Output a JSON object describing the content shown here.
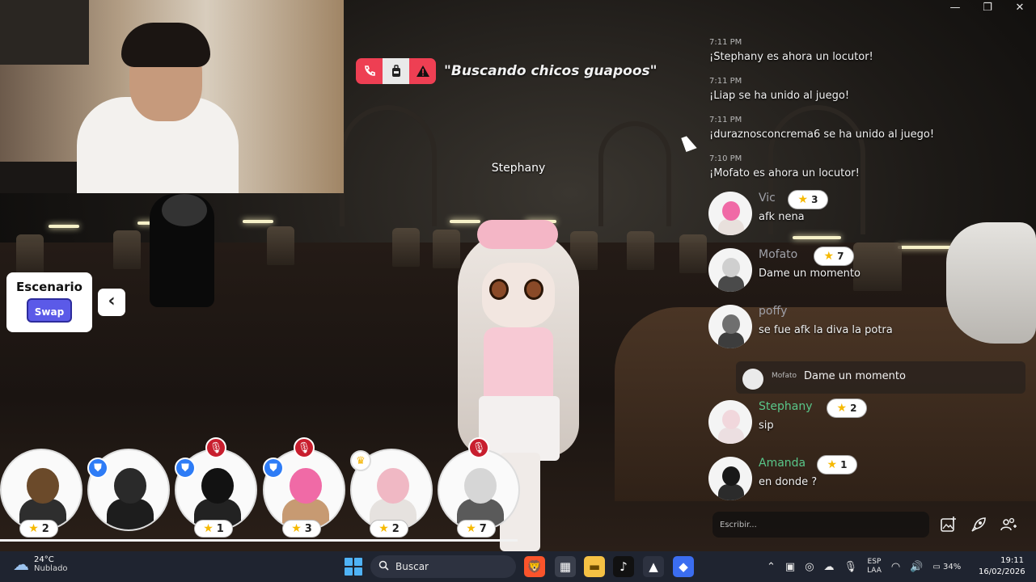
{
  "window": {
    "minimize": "—",
    "maximize": "❐",
    "close": "✕"
  },
  "banner": {
    "status_text": "\"Buscando chicos guapoos\"",
    "icons": [
      "phone-icon",
      "backpack-icon",
      "warning-icon"
    ]
  },
  "scene": {
    "player_name": "Stephany"
  },
  "escenario": {
    "title": "Escenario",
    "swap_label": "Swap",
    "collapse_glyph": "‹"
  },
  "speakers": [
    {
      "level": "2",
      "badge": "none",
      "colors": {
        "head": "#6b4a2a",
        "body": "#2e2e2e"
      }
    },
    {
      "level": "",
      "badge": "shield",
      "colors": {
        "head": "#2a2a2a",
        "body": "#1d1d1d"
      }
    },
    {
      "level": "1",
      "badge": "shield+muted",
      "colors": {
        "head": "#121212",
        "body": "#222"
      }
    },
    {
      "level": "3",
      "badge": "shield+muted",
      "colors": {
        "head": "#f06aa6",
        "body": "#c79a72"
      }
    },
    {
      "level": "2",
      "badge": "crown",
      "colors": {
        "head": "#f0b8c4",
        "body": "#e6e2df"
      }
    },
    {
      "level": "7",
      "badge": "muted",
      "colors": {
        "head": "#d6d6d6",
        "body": "#5a5a5a"
      }
    }
  ],
  "chat": {
    "system_messages": [
      {
        "time": "7:11 PM",
        "text": "¡Stephany es ahora un locutor!"
      },
      {
        "time": "7:11 PM",
        "text": "¡Liap se ha unido al juego!"
      },
      {
        "time": "7:11 PM",
        "text": "¡duraznosconcrema6 se ha unido al juego!"
      },
      {
        "time": "7:10 PM",
        "text": "¡Mofato es ahora un locutor!"
      }
    ],
    "messages": [
      {
        "name": "Vic",
        "level": "3",
        "text": "afk nena",
        "name_color": "#9fa0a8",
        "avatar": {
          "head": "#f06aa6",
          "body": "#e8e0dc"
        }
      },
      {
        "name": "Mofato",
        "level": "7",
        "text": "Dame un momento",
        "name_color": "#9fa0a8",
        "avatar": {
          "head": "#cfcfcf",
          "body": "#4a4a4a"
        }
      },
      {
        "name": "poffy",
        "level": "",
        "text": "se fue afk la diva la potra",
        "name_color": "#9fa0a8",
        "avatar": {
          "head": "#6f6f6f",
          "body": "#3d3d3d"
        }
      },
      {
        "name": "Stephany",
        "level": "2",
        "text": "sip",
        "name_color": "#59c689",
        "avatar": {
          "head": "#f1d7dc",
          "body": "#ecdfe1"
        }
      },
      {
        "name": "Amanda",
        "level": "1",
        "text": "en donde ?",
        "name_color": "#59c689",
        "avatar": {
          "head": "#181818",
          "body": "#2b2b2b"
        }
      }
    ],
    "reply_preview": {
      "name": "Mofato",
      "text": "Dame un momento"
    },
    "input_placeholder": "Escribir...",
    "actions": [
      "image-add-icon",
      "rocket-icon",
      "people-icon"
    ]
  },
  "taskbar": {
    "weather_temp": "24°C",
    "weather_desc": "Nublado",
    "search_label": "Buscar",
    "lang_line1": "ESP",
    "lang_line2": "LAA",
    "battery": "34%",
    "time": "19:11",
    "date": "16/02/2026"
  }
}
